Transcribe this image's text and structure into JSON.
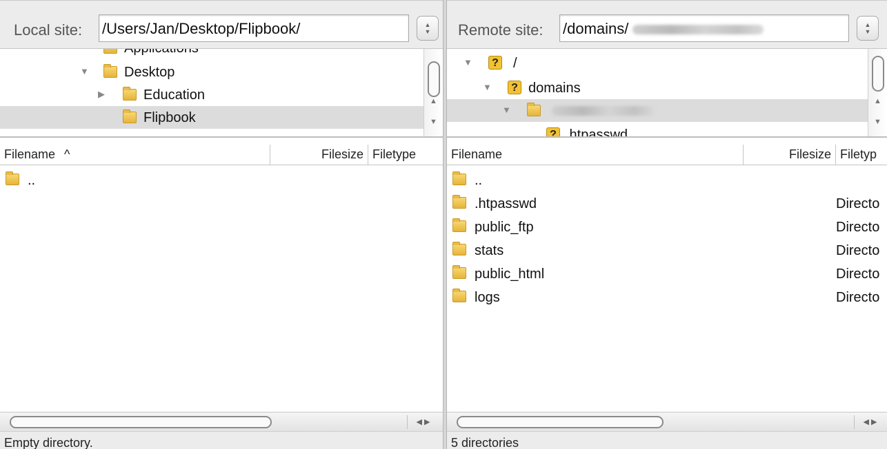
{
  "local": {
    "site_label": "Local site:",
    "site_path": "/Users/Jan/Desktop/Flipbook/",
    "tree": [
      {
        "label": "Applications",
        "level": 2,
        "expanded": null,
        "icon": "folder-icon",
        "partial": true
      },
      {
        "label": "Desktop",
        "level": 2,
        "expanded": true,
        "icon": "folder-icon"
      },
      {
        "label": "Education",
        "level": 3,
        "expanded": false,
        "icon": "folder-icon"
      },
      {
        "label": "Flipbook",
        "level": 3,
        "expanded": null,
        "icon": "folder-icon",
        "selected": true
      }
    ],
    "columns": {
      "filename": "Filename",
      "filesize": "Filesize",
      "filetype": "Filetype"
    },
    "sort_indicator": "^",
    "files": [
      {
        "name": "..",
        "type": ""
      }
    ],
    "status": "Empty directory."
  },
  "remote": {
    "site_label": "Remote site:",
    "site_path": "/domains/",
    "tree": [
      {
        "label": "/",
        "level": 1,
        "expanded": true,
        "icon": "question-icon"
      },
      {
        "label": "domains",
        "level": 2,
        "expanded": true,
        "icon": "question-icon"
      },
      {
        "label": "",
        "level": 3,
        "expanded": true,
        "icon": "folder-icon",
        "selected": true,
        "redacted": true
      },
      {
        "label": ".htpasswd",
        "level": 4,
        "expanded": null,
        "icon": "question-icon",
        "partial": true
      }
    ],
    "columns": {
      "filename": "Filename",
      "filesize": "Filesize",
      "filetype": "Filetyp"
    },
    "files": [
      {
        "name": "..",
        "type": ""
      },
      {
        "name": ".htpasswd",
        "type": "Directo"
      },
      {
        "name": "public_ftp",
        "type": "Directo"
      },
      {
        "name": "stats",
        "type": "Directo"
      },
      {
        "name": "public_html",
        "type": "Directo"
      },
      {
        "name": "logs",
        "type": "Directo"
      }
    ],
    "status": "5 directories"
  },
  "glyphs": {
    "expanded": "▼",
    "collapsed": "▶",
    "up": "▲",
    "down": "▼",
    "left": "◀",
    "right": "▶",
    "question": "?"
  },
  "colors": {
    "selection": "#dcdcdc",
    "folder": "#f0c850",
    "question_icon": "#f2c232"
  }
}
